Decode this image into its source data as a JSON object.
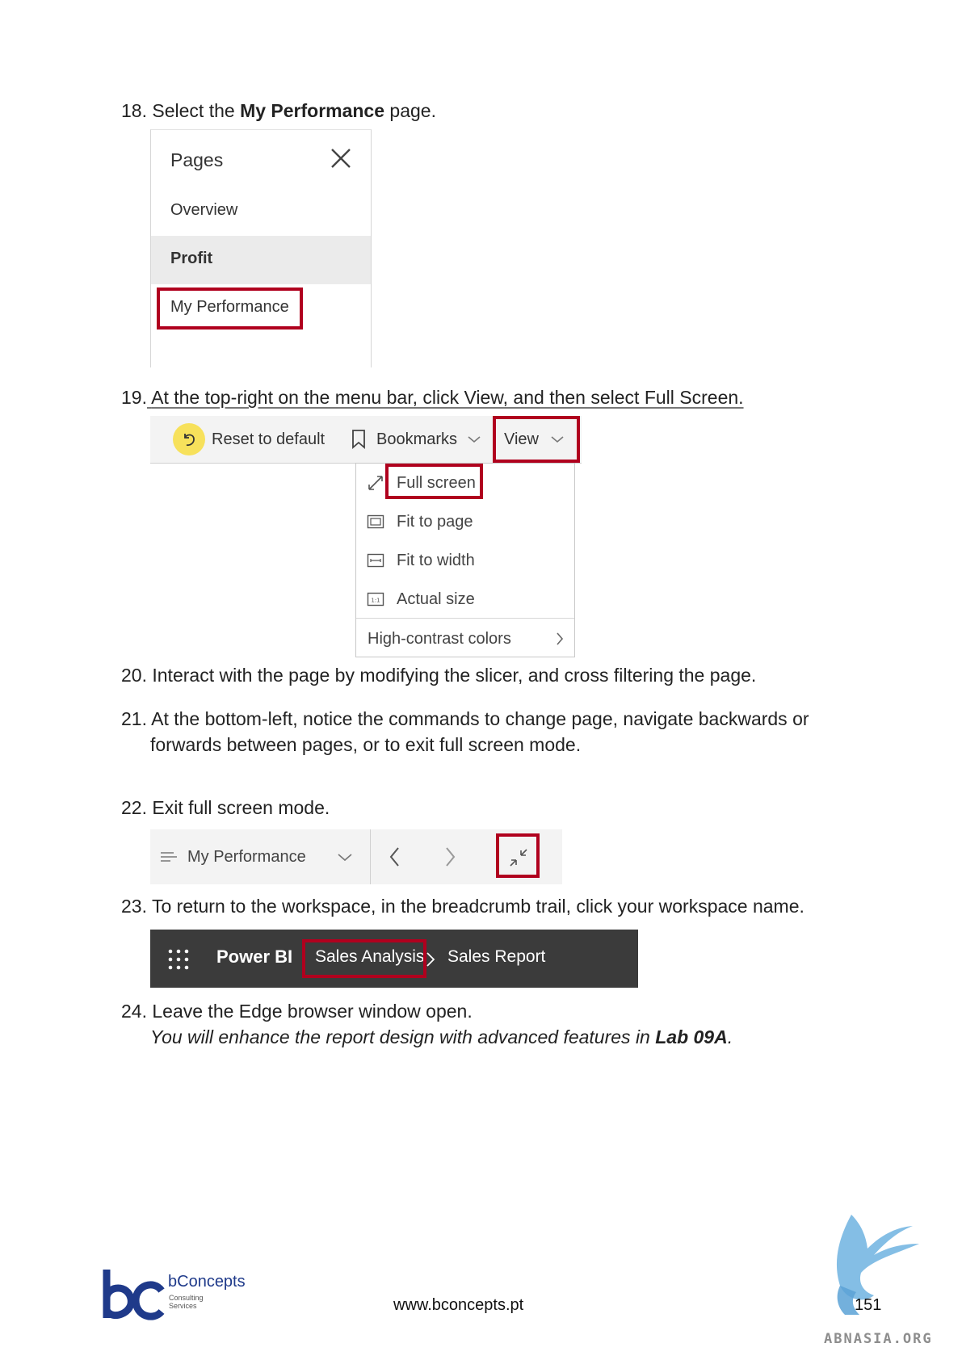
{
  "steps": {
    "s18": {
      "num": "18.",
      "pre": "Select the ",
      "bold": "My Performance",
      "post": " page."
    },
    "s19": {
      "num": "19.",
      "text": "At the top-right on the menu bar, click View, and then select Full Screen."
    },
    "s20": {
      "num": "20.",
      "text": "Interact with the page by modifying the slicer, and cross filtering the page."
    },
    "s21": {
      "num": "21.",
      "line1": "At the bottom-left, notice the commands to change page, navigate backwards or",
      "line2": "forwards between pages, or to exit full screen mode."
    },
    "s22": {
      "num": "22.",
      "text": "Exit full screen mode."
    },
    "s23": {
      "num": "23.",
      "text": "To return to the workspace, in the breadcrumb trail, click your workspace name."
    },
    "s24": {
      "num": "24.",
      "text": "Leave the Edge browser window open.",
      "note_pre": "You will enhance the report design with advanced features in ",
      "note_bold": "Lab 09A",
      "note_post": "."
    }
  },
  "pages_panel": {
    "title": "Pages",
    "items": [
      "Overview",
      "Profit",
      "My Performance"
    ],
    "active": "Profit",
    "highlighted": "My Performance"
  },
  "toolbar": {
    "reset": "Reset to default",
    "bookmarks": "Bookmarks",
    "view": "View"
  },
  "view_menu": {
    "items": [
      {
        "label": "Full screen",
        "icon": "full-screen-icon"
      },
      {
        "label": "Fit to page",
        "icon": "fit-to-page-icon"
      },
      {
        "label": "Fit to width",
        "icon": "fit-to-width-icon"
      },
      {
        "label": "Actual size",
        "icon": "actual-size-icon"
      }
    ],
    "high_contrast": "High-contrast colors",
    "actual_size_glyph": "1:1"
  },
  "navbar": {
    "page_name": "My Performance"
  },
  "breadcrumb": {
    "app": "Power BI",
    "workspace": "Sales Analysis",
    "report": "Sales Report"
  },
  "footer": {
    "brand": "bConcepts",
    "brand_sub1": "Consulting",
    "brand_sub2": "Services",
    "url": "www.bconcepts.pt",
    "page": "151",
    "watermark": "ABNASIA.ORG"
  },
  "colors": {
    "highlight": "#b0001e",
    "brand_blue": "#1f3a8a",
    "watermark_blue": "#6fb3e0"
  }
}
